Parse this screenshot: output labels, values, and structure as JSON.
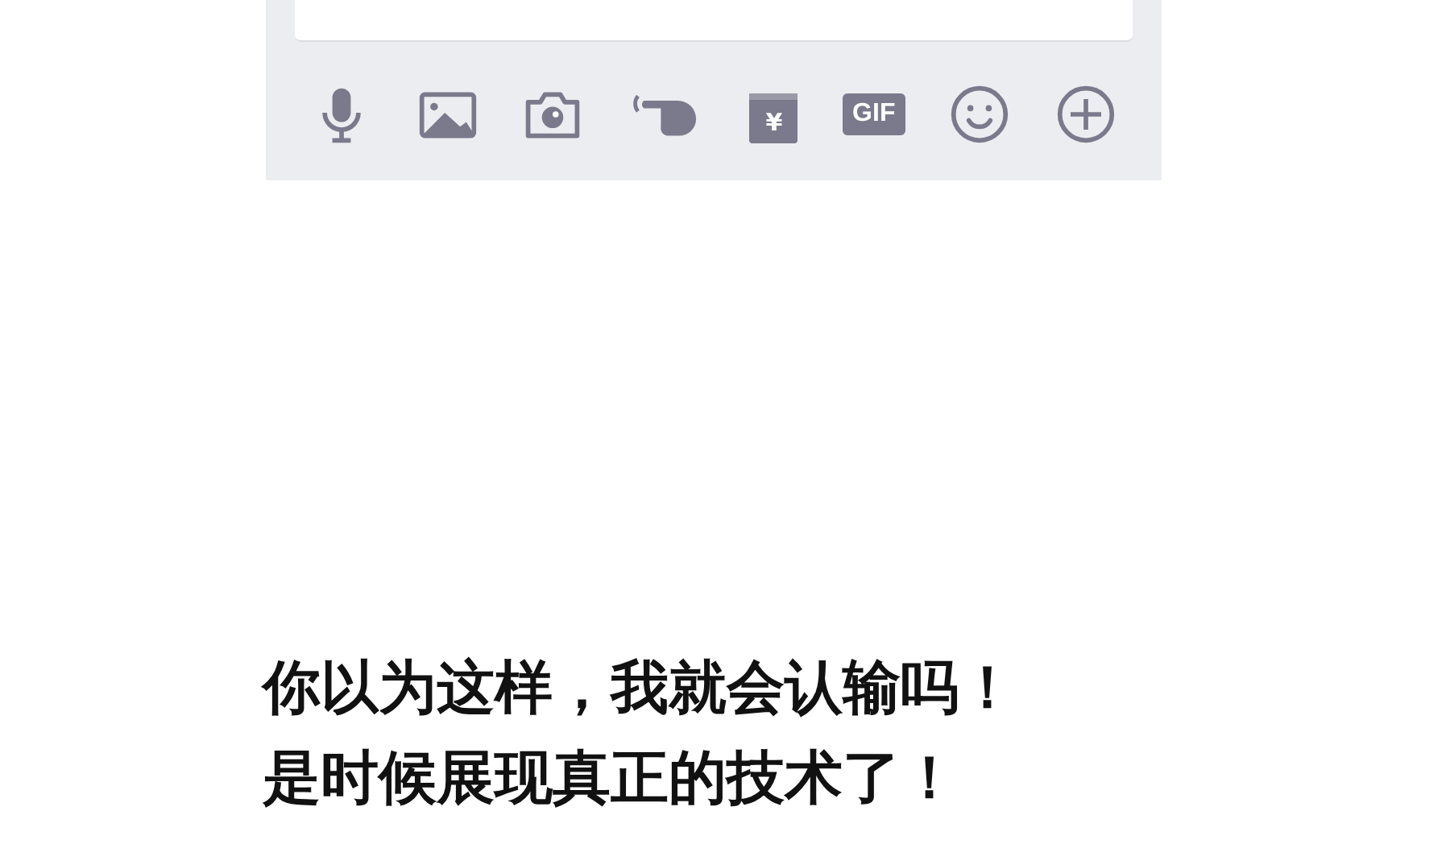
{
  "toolbar": [
    {
      "kind": "mic"
    },
    {
      "kind": "image"
    },
    {
      "kind": "camera"
    },
    {
      "kind": "poke"
    },
    {
      "kind": "redpacket",
      "label": "¥"
    },
    {
      "kind": "gif",
      "label": "GIF"
    },
    {
      "kind": "emoji"
    },
    {
      "kind": "plus"
    }
  ],
  "caption": [
    "你以为这样，我就会认输吗！",
    "是时候展现真正的技术了！"
  ]
}
